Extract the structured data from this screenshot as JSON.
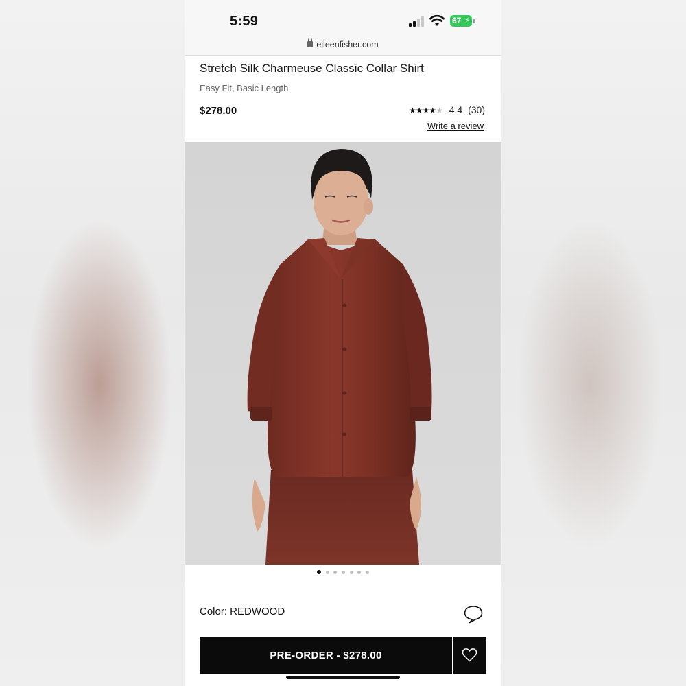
{
  "status_bar": {
    "time": "5:59",
    "battery": "67",
    "battery_color": "#34c759"
  },
  "browser": {
    "url": "eileenfisher.com"
  },
  "product": {
    "title": "Stretch Silk Charmeuse Classic Collar Shirt",
    "subtitle": "Easy Fit, Basic Length",
    "price": "$278.00",
    "rating_stars": "★★★★",
    "rating_half_star": "★",
    "rating_value": "4.4",
    "rating_fraction": 0.88,
    "review_count": "(30)",
    "write_review": "Write a review",
    "image_count": 7,
    "active_image": 1,
    "color_label": "Color: REDWOOD",
    "shirt_color": "#7e3126",
    "preorder_button": "PRE-ORDER - $278.00"
  },
  "icons": {
    "lock": "lock-icon",
    "chat": "chat-bubble-icon",
    "wishlist": "heart-icon",
    "signal": "cellular-signal-icon",
    "wifi": "wifi-icon"
  }
}
